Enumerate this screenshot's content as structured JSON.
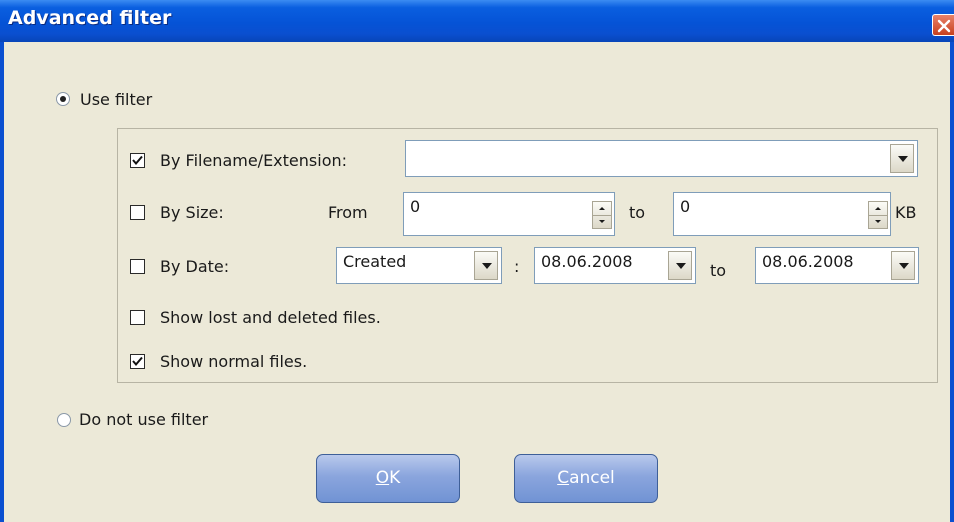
{
  "window": {
    "title": "Advanced filter",
    "close_icon": "close-icon",
    "accent": "#0553d6"
  },
  "use_filter": {
    "label": "Use filter",
    "selected": true
  },
  "do_not_use_filter": {
    "label": "Do not use filter",
    "selected": false
  },
  "filters": {
    "by_filename": {
      "label": "By Filename/Extension:",
      "checked": true,
      "value": ""
    },
    "by_size": {
      "label": "By Size:",
      "checked": false,
      "from_label": "From",
      "from_value": "0",
      "to_label": "to",
      "to_value": "0",
      "unit": "KB"
    },
    "by_date": {
      "label": "By Date:",
      "checked": false,
      "mode": "Created",
      "colon": ":",
      "from_date": "08.06.2008",
      "to_label": "to",
      "to_date": "08.06.2008"
    },
    "show_lost": {
      "label": "Show lost and deleted files.",
      "checked": false
    },
    "show_normal": {
      "label": "Show normal files.",
      "checked": true
    }
  },
  "buttons": {
    "ok": {
      "mnemonic": "O",
      "rest": "K"
    },
    "cancel": {
      "mnemonic": "C",
      "rest": "ancel"
    }
  }
}
